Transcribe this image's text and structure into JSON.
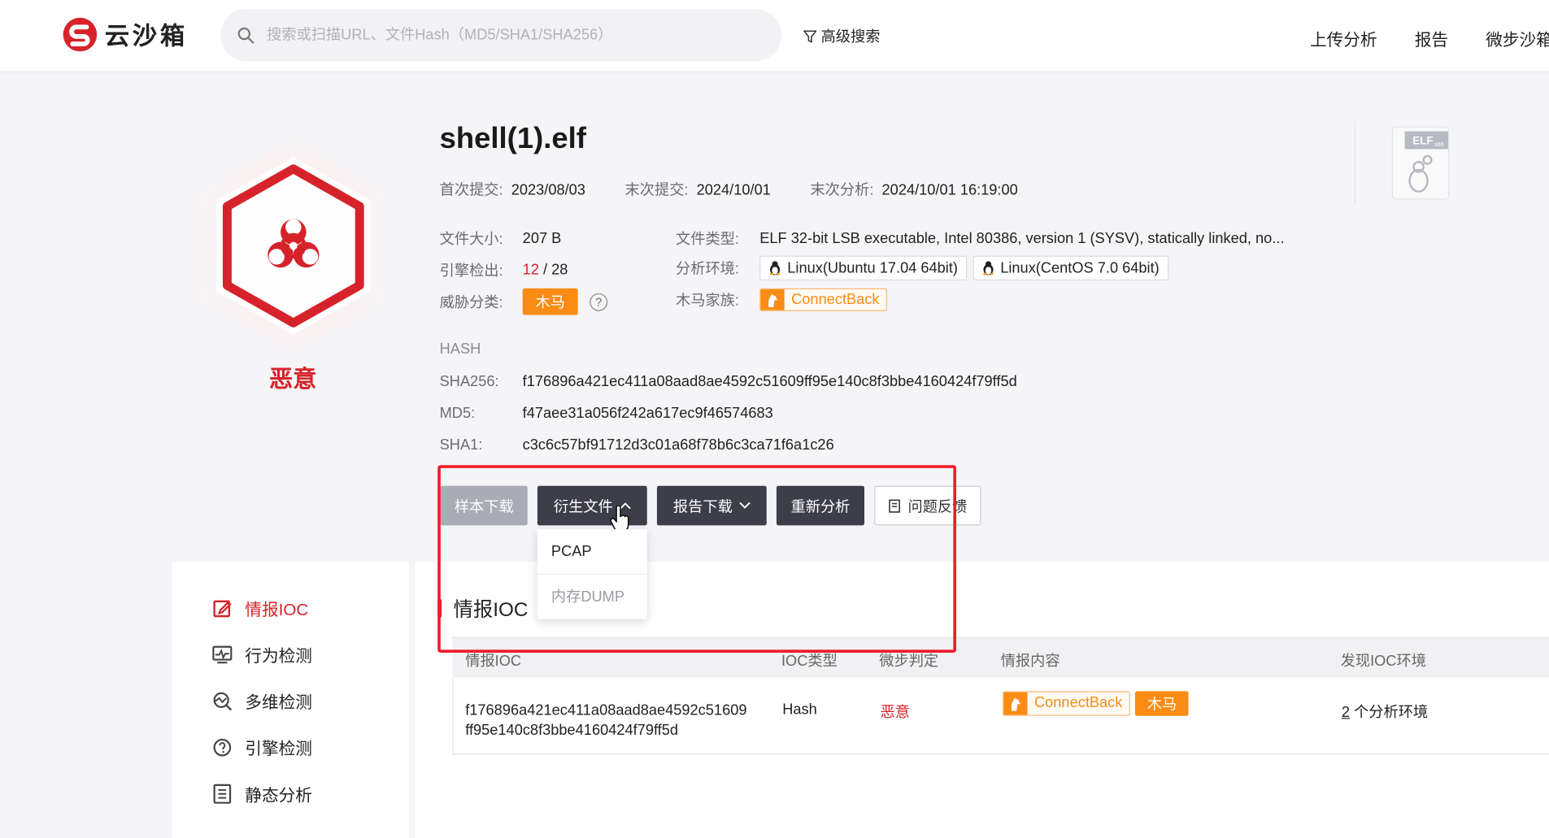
{
  "header": {
    "logo_text": "云沙箱",
    "search_placeholder": "搜索或扫描URL、文件Hash（MD5/SHA1/SHA256）",
    "advanced_search": "高级搜索",
    "nav": [
      "上传分析",
      "报告",
      "微步沙箱"
    ]
  },
  "file": {
    "name": "shell(1).elf",
    "verdict": "恶意",
    "first_submit_label": "首次提交:",
    "first_submit": "2023/08/03",
    "last_submit_label": "末次提交:",
    "last_submit": "2024/10/01",
    "last_analysis_label": "末次分析:",
    "last_analysis": "2024/10/01 16:19:00",
    "size_label": "文件大小:",
    "size": "207 B",
    "engine_label": "引擎检出:",
    "engine_detected": "12",
    "engine_total": "/ 28",
    "threat_label": "威胁分类:",
    "threat": "木马",
    "type_label": "文件类型:",
    "type": "ELF 32-bit LSB executable, Intel 80386, version 1 (SYSV), statically linked, no...",
    "env_label": "分析环境:",
    "envs": [
      "Linux(Ubuntu 17.04 64bit)",
      "Linux(CentOS 7.0 64bit)"
    ],
    "family_label": "木马家族:",
    "family": "ConnectBack",
    "elf_badge": "ELF",
    "elf_arch": "x86"
  },
  "hash": {
    "title": "HASH",
    "sha256_label": "SHA256:",
    "sha256": "f176896a421ec411a08aad8ae4592c51609ff95e140c8f3bbe4160424f79ff5d",
    "md5_label": "MD5:",
    "md5": "f47aee31a056f242a617ec9f46574683",
    "sha1_label": "SHA1:",
    "sha1": "c3c6c57bf91712d3c01a68f78b6c3ca71f6a1c26"
  },
  "actions": {
    "sample_download": "样本下载",
    "derived_files": "衍生文件",
    "report_download": "报告下载",
    "reanalyze": "重新分析",
    "feedback": "问题反馈",
    "dropdown": [
      "PCAP",
      "内存DUMP"
    ]
  },
  "sidebar": [
    "情报IOC",
    "行为检测",
    "多维检测",
    "引擎检测",
    "静态分析"
  ],
  "ioc": {
    "title": "情报IOC",
    "columns": [
      "情报IOC",
      "IOC类型",
      "微步判定",
      "情报内容",
      "发现IOC环境"
    ],
    "row": {
      "ioc_line1": "f176896a421ec411a08aad8ae4592c51609",
      "ioc_line2": "ff95e140c8f3bbe4160424f79ff5d",
      "type": "Hash",
      "verdict": "恶意",
      "family": "ConnectBack",
      "tag": "木马",
      "env_count": "2",
      "env_text": "个分析环境"
    }
  },
  "colors": {
    "malicious": "#d6232b",
    "orange": "#fa8c16",
    "highlight": "#ef1c2a"
  }
}
